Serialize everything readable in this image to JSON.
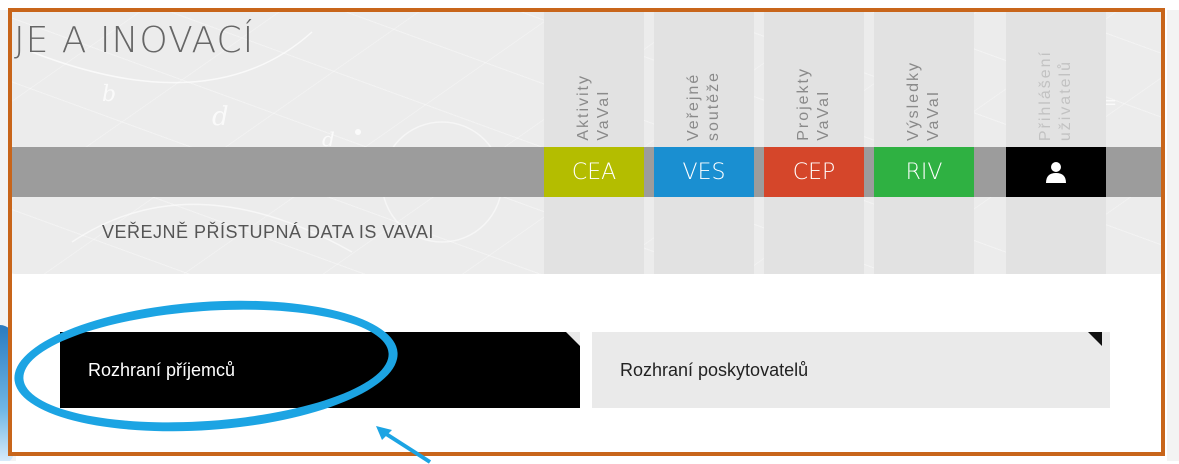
{
  "header": {
    "site_title": "JE A INOVACÍ",
    "subtitle": "VEŘEJNĚ PŘÍSTUPNÁ DATA IS VAVAI"
  },
  "nav": [
    {
      "label": "Aktivity\nVaVaI"
    },
    {
      "label": "Veřejné\nsoutěže"
    },
    {
      "label": "Projekty\nVaVaI"
    },
    {
      "label": "Výsledky\nVaVaI"
    },
    {
      "label": "Přihlášení\nuživatelů"
    }
  ],
  "tags": [
    {
      "label": "CEA",
      "color": "#b4bd00"
    },
    {
      "label": "VES",
      "color": "#1a8fd1"
    },
    {
      "label": "CEP",
      "color": "#d5462a"
    },
    {
      "label": "RIV",
      "color": "#2fb142"
    }
  ],
  "user_icon": "user-icon",
  "tabs": {
    "receivers": "Rozhraní příjemců",
    "providers": "Rozhraní poskytovatelů"
  },
  "annotation": {
    "color": "#1ca4e3"
  },
  "frame": {
    "color": "#c8651a"
  }
}
